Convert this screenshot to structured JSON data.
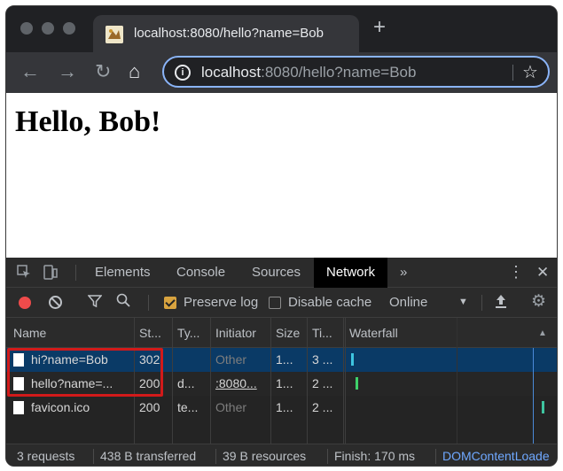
{
  "browser": {
    "tab_title": "localhost:8080/hello?name=Bob",
    "new_tab_glyph": "+",
    "url_host": "localhost",
    "url_rest": ":8080/hello?name=Bob",
    "icons": [
      "back-icon",
      "forward-icon",
      "reload-icon",
      "home-icon",
      "info-icon",
      "star-icon"
    ]
  },
  "page": {
    "heading": "Hello, Bob!"
  },
  "devtools": {
    "tabs": [
      "Elements",
      "Console",
      "Sources",
      "Network"
    ],
    "active_tab": "Network",
    "more_tabs_glyph": "»",
    "toolbar": {
      "preserve_log": {
        "label": "Preserve log",
        "checked": true
      },
      "disable_cache": {
        "label": "Disable cache",
        "checked": false
      },
      "throttling": "Online"
    },
    "columns": [
      "Name",
      "St...",
      "Ty...",
      "Initiator",
      "Size",
      "Ti...",
      "Waterfall"
    ],
    "rows": [
      {
        "name": "hi?name=Bob",
        "status": "302",
        "type": "",
        "initiator": "Other",
        "size": "1...",
        "time": "3 ..."
      },
      {
        "name": "hello?name=...",
        "status": "200",
        "type": "d...",
        "initiator": ":8080...",
        "size": "1...",
        "time": "2 ..."
      },
      {
        "name": "favicon.ico",
        "status": "200",
        "type": "te...",
        "initiator": "Other",
        "size": "1...",
        "time": "2 ..."
      }
    ],
    "status_bar": {
      "requests": "3 requests",
      "transferred": "438 B transferred",
      "resources": "39 B resources",
      "finish": "Finish: 170 ms",
      "dom_content_loaded": "DOMContentLoade"
    },
    "colors": {
      "record": "#ef4b4b",
      "checkbox": "#d8a33f",
      "selected_row": "#0a3a66",
      "highlight": "#d21a1a",
      "link": "#6fa8ff"
    }
  }
}
